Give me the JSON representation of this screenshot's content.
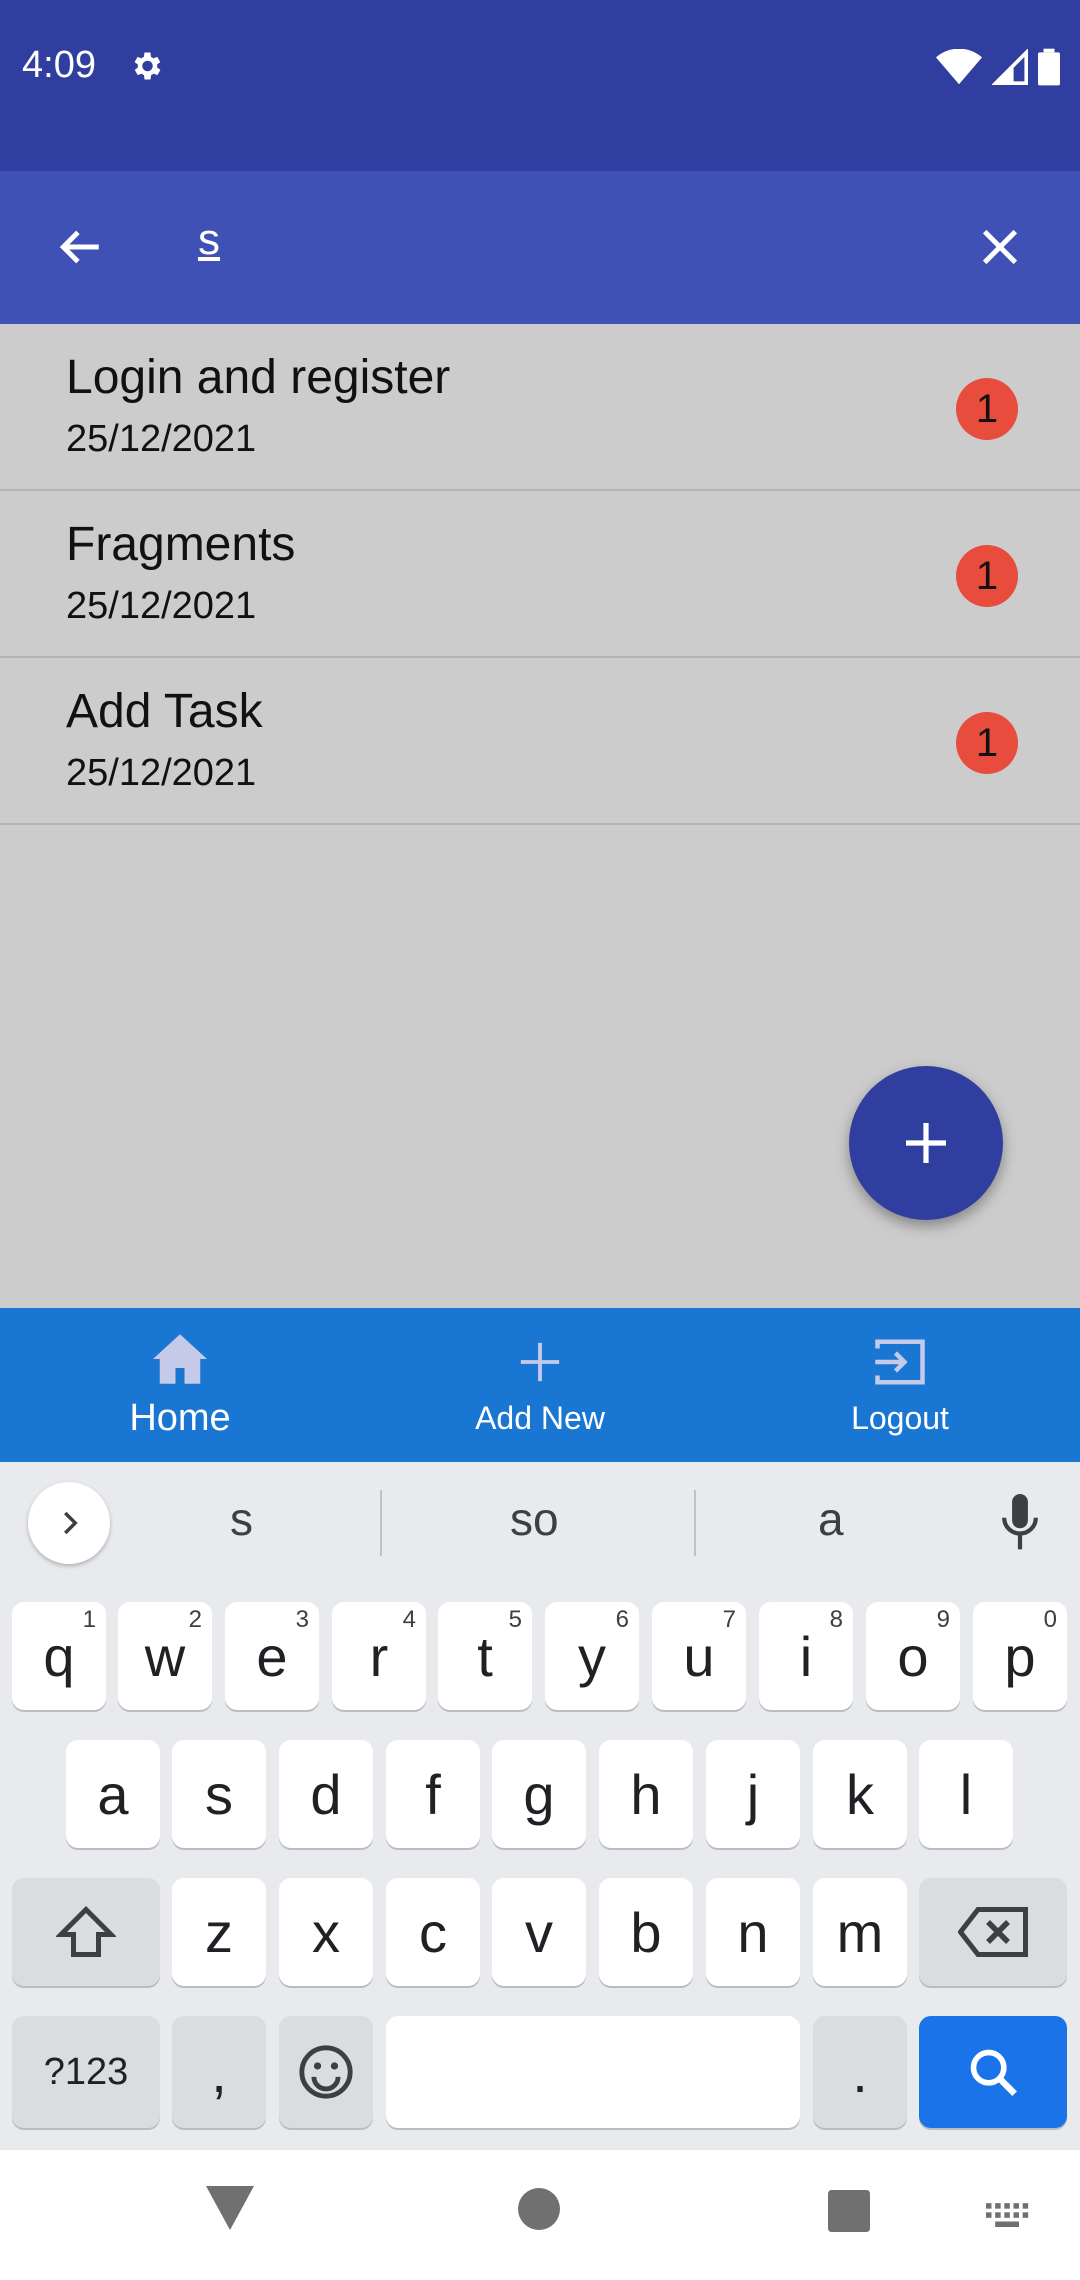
{
  "status_bar": {
    "time": "4:09"
  },
  "search": {
    "query": "s"
  },
  "tasks": [
    {
      "title": "Login and register",
      "date": "25/12/2021",
      "count": "1"
    },
    {
      "title": "Fragments",
      "date": "25/12/2021",
      "count": "1"
    },
    {
      "title": "Add Task",
      "date": "25/12/2021",
      "count": "1"
    }
  ],
  "bottom_nav": {
    "home": "Home",
    "add_new": "Add New",
    "logout": "Logout"
  },
  "keyboard": {
    "suggestions": [
      "s",
      "so",
      "a"
    ],
    "row1": [
      "q",
      "w",
      "e",
      "r",
      "t",
      "y",
      "u",
      "i",
      "o",
      "p"
    ],
    "row1_hints": [
      "1",
      "2",
      "3",
      "4",
      "5",
      "6",
      "7",
      "8",
      "9",
      "0"
    ],
    "row2": [
      "a",
      "s",
      "d",
      "f",
      "g",
      "h",
      "j",
      "k",
      "l"
    ],
    "row3": [
      "z",
      "x",
      "c",
      "v",
      "b",
      "n",
      "m"
    ],
    "symbols_label": "?123",
    "comma": ",",
    "period": "."
  },
  "colors": {
    "status_bar": "#303f9f",
    "app_bar": "#3f51b5",
    "bottom_nav": "#1976d2",
    "badge": "#e74c3c",
    "fab": "#303f9f",
    "search_key": "#1a73e8"
  }
}
